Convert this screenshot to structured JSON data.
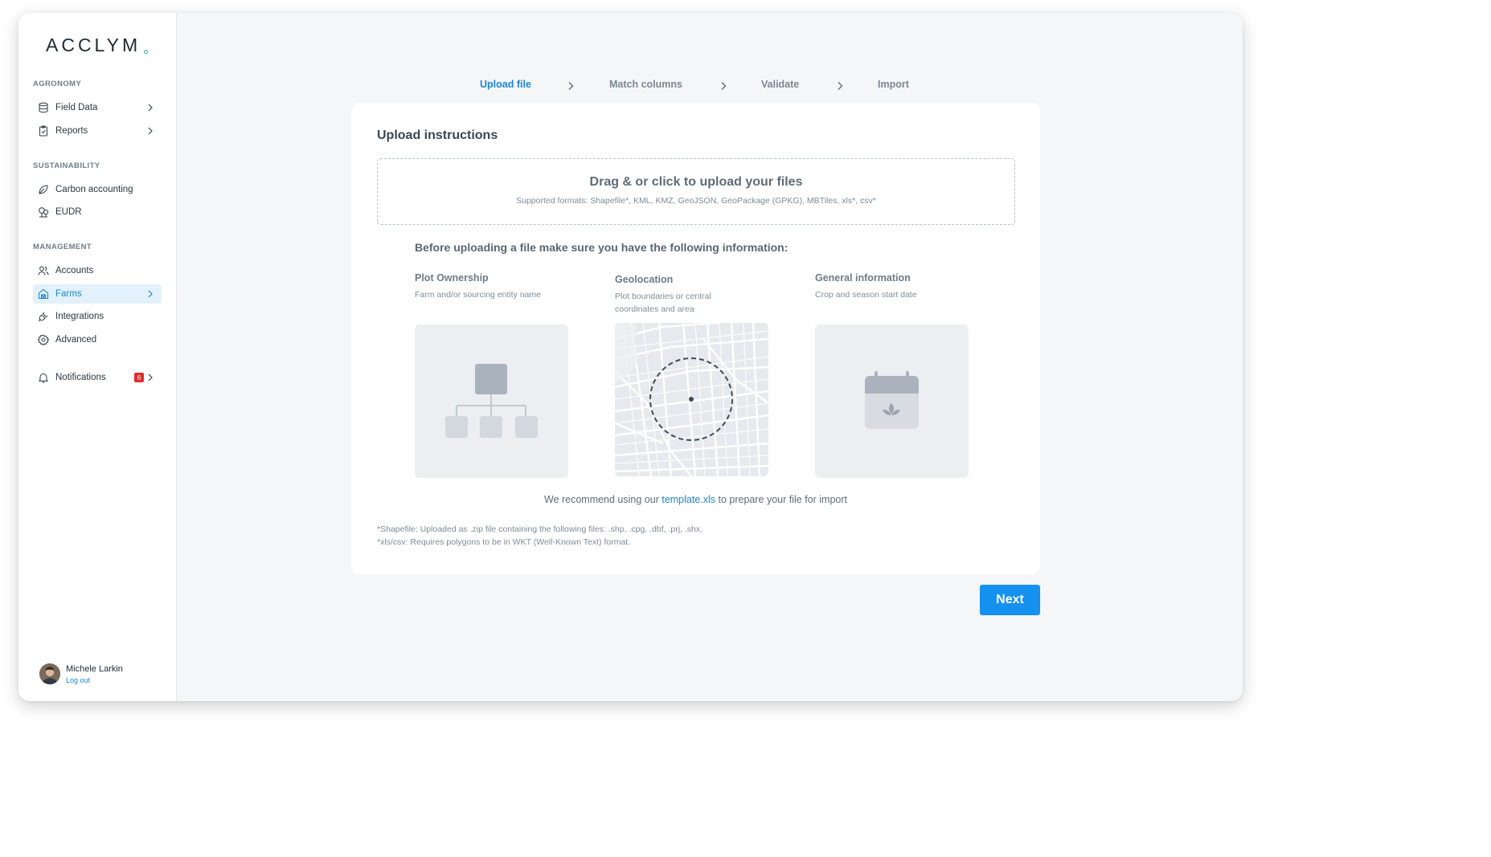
{
  "app": {
    "logo_text": "ACCLYM"
  },
  "sidebar": {
    "sections": [
      {
        "title": "AGRONOMY",
        "items": [
          {
            "label": "Field Data",
            "icon": "database-icon",
            "has_chevron": true
          },
          {
            "label": "Reports",
            "icon": "clipboard-icon",
            "has_chevron": true
          }
        ]
      },
      {
        "title": "SUSTAINABILITY",
        "items": [
          {
            "label": "Carbon accounting",
            "icon": "leaf-icon",
            "has_chevron": false
          },
          {
            "label": "EUDR",
            "icon": "trees-icon",
            "has_chevron": false
          }
        ]
      },
      {
        "title": "MANAGEMENT",
        "items": [
          {
            "label": "Accounts",
            "icon": "users-icon",
            "has_chevron": false
          },
          {
            "label": "Farms",
            "icon": "farm-icon",
            "has_chevron": true,
            "active": true
          },
          {
            "label": "Integrations",
            "icon": "plug-icon",
            "has_chevron": false
          },
          {
            "label": "Advanced",
            "icon": "gear-icon",
            "has_chevron": false
          }
        ]
      }
    ],
    "notifications": {
      "label": "Notifications",
      "icon": "bell-icon",
      "count": "6"
    },
    "user": {
      "name": "Michele Larkin",
      "logout_label": "Log out"
    }
  },
  "stepper": {
    "steps": [
      {
        "label": "Upload file",
        "current": true
      },
      {
        "label": "Match columns",
        "current": false
      },
      {
        "label": "Validate",
        "current": false
      },
      {
        "label": "Import",
        "current": false
      }
    ]
  },
  "upload": {
    "title": "Upload instructions",
    "dropzone_title": "Drag &  or click to upload your files",
    "dropzone_formats": "Supported formats: Shapefile*, KML, KMZ, GeoJSON, GeoPackage (GPKG), MBTiles, xls*, csv*",
    "before_heading": "Before uploading a file make sure you have the following information:",
    "requirements": [
      {
        "title": "Plot Ownership",
        "desc_lines": [
          "Farm and/or sourcing entity name"
        ],
        "icon": "hierarchy-icon"
      },
      {
        "title": "Geolocation",
        "desc_lines": [
          "Plot boundaries or central",
          "coordinates and area"
        ],
        "icon": "map-icon"
      },
      {
        "title": "General information",
        "desc_lines": [
          "Crop and season start date"
        ],
        "icon": "calendar-icon"
      }
    ],
    "recommend_prefix": "We recommend using our ",
    "recommend_link": "template.xls",
    "recommend_suffix": " to prepare your file for import",
    "footnotes": [
      "*Shapefile: Uploaded as .zip file containing the following files: .shp, .cpg, .dbf, .prj, .shx.",
      "*xls/csv: Requires polygons to be in WKT (Well-Known Text) format."
    ]
  },
  "actions": {
    "next_label": "Next"
  },
  "colors": {
    "accent": "#1591ef",
    "link": "#1a86d9",
    "badge": "#e02d2d",
    "active_bg": "#e3f1fc"
  }
}
